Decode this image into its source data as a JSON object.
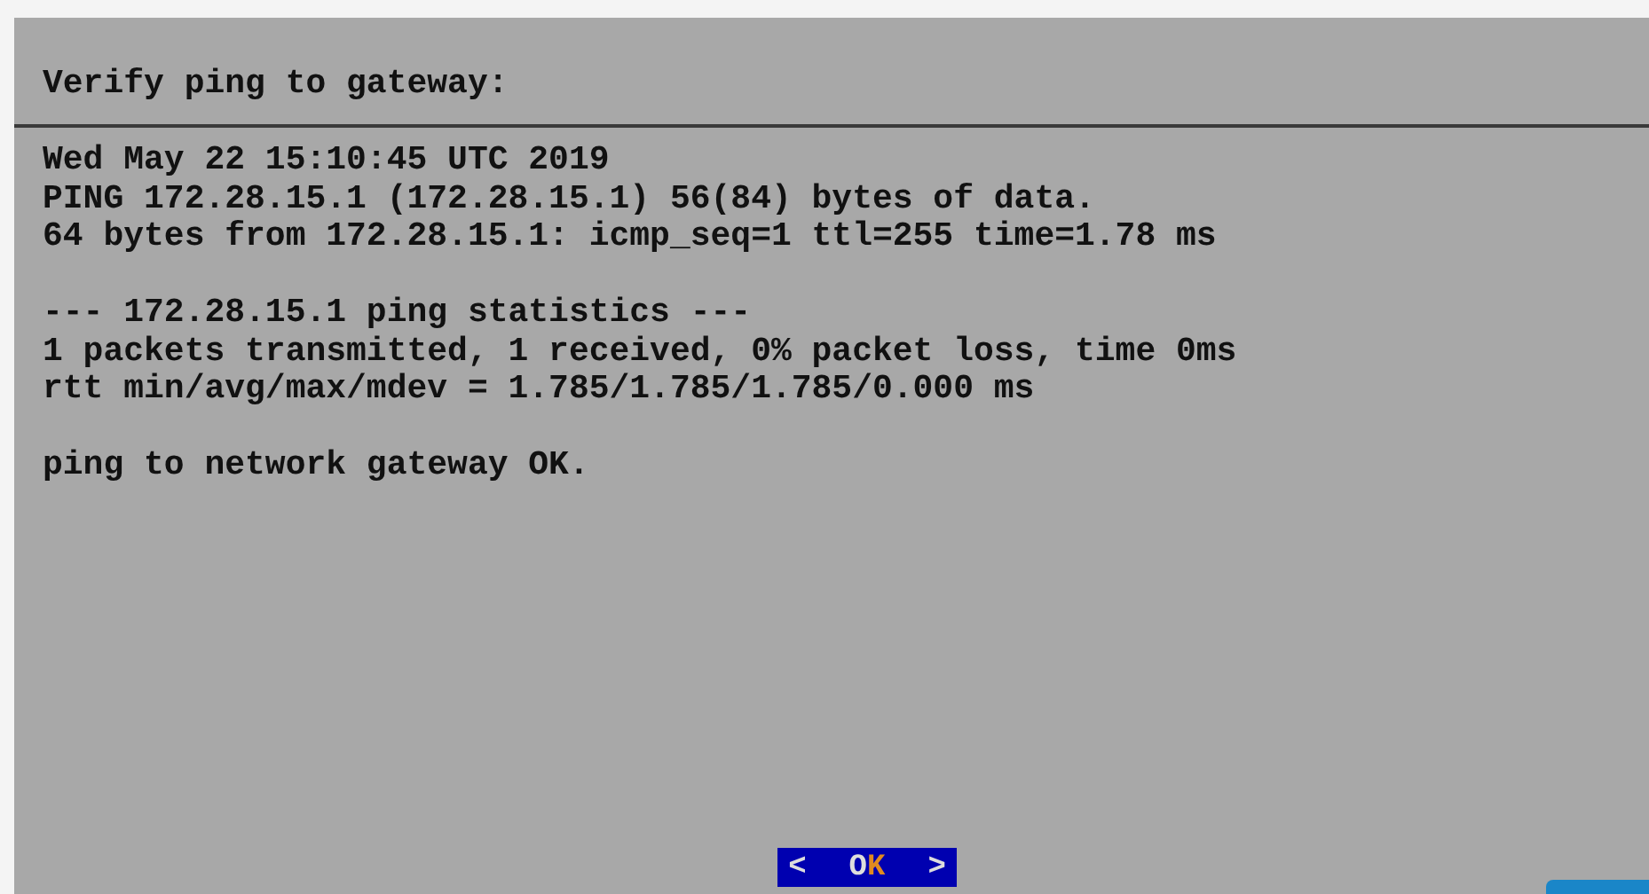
{
  "dialog": {
    "title": "Verify ping to gateway:",
    "output_blocks": [
      [
        "Wed May 22 15:10:45 UTC 2019",
        "PING 172.28.15.1 (172.28.15.1) 56(84) bytes of data.",
        "64 bytes from 172.28.15.1: icmp_seq=1 ttl=255 time=1.78 ms"
      ],
      [
        "--- 172.28.15.1 ping statistics ---",
        "1 packets transmitted, 1 received, 0% packet loss, time 0ms",
        "rtt min/avg/max/mdev = 1.785/1.785/1.785/0.000 ms"
      ],
      [
        "ping to network gateway OK."
      ]
    ],
    "button": {
      "left": "<",
      "right": ">",
      "label_parts": [
        {
          "text": "O",
          "hotkey": false
        },
        {
          "text": "K",
          "hotkey": true
        }
      ],
      "selected": true
    }
  }
}
